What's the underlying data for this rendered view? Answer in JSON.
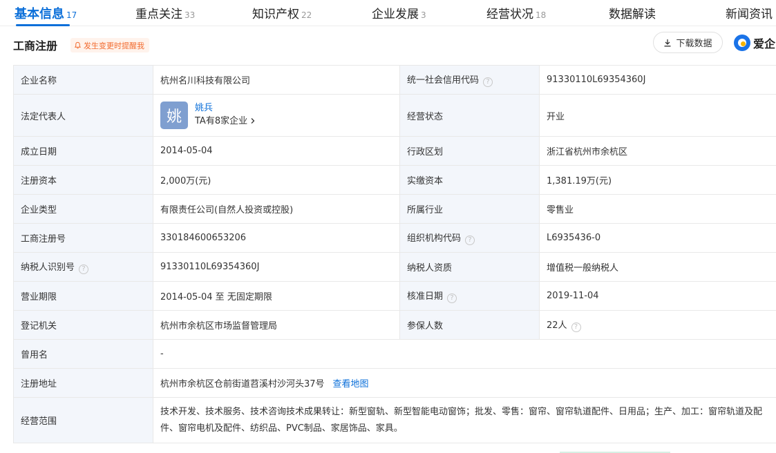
{
  "tabs": [
    {
      "label": "基本信息",
      "count": "17"
    },
    {
      "label": "重点关注",
      "count": "33"
    },
    {
      "label": "知识产权",
      "count": "22"
    },
    {
      "label": "企业发展",
      "count": "3"
    },
    {
      "label": "经营状况",
      "count": "18"
    },
    {
      "label": "数据解读",
      "count": ""
    },
    {
      "label": "新闻资讯",
      "count": ""
    }
  ],
  "section": {
    "title": "工商注册",
    "remind_label": "发生变更时提醒我",
    "download_label": "下载数据",
    "brand_label": "爱企"
  },
  "fields": {
    "company_name": {
      "label": "企业名称",
      "value": "杭州名川科技有限公司"
    },
    "credit_code": {
      "label": "统一社会信用代码",
      "value": "91330110L69354360J"
    },
    "legal_rep": {
      "label": "法定代表人",
      "avatar_char": "姚",
      "name": "姚兵",
      "companies": "TA有8家企业"
    },
    "status": {
      "label": "经营状态",
      "value": "开业"
    },
    "founded": {
      "label": "成立日期",
      "value": "2014-05-04"
    },
    "region": {
      "label": "行政区划",
      "value": "浙江省杭州市余杭区"
    },
    "reg_capital": {
      "label": "注册资本",
      "value": "2,000万(元)"
    },
    "paid_capital": {
      "label": "实缴资本",
      "value": "1,381.19万(元)"
    },
    "type": {
      "label": "企业类型",
      "value": "有限责任公司(自然人投资或控股)"
    },
    "industry": {
      "label": "所属行业",
      "value": "零售业"
    },
    "reg_no": {
      "label": "工商注册号",
      "value": "330184600653206"
    },
    "org_code": {
      "label": "组织机构代码",
      "value": "L6935436-0"
    },
    "taxpayer_id": {
      "label": "纳税人识别号",
      "value": "91330110L69354360J"
    },
    "taxpayer_qual": {
      "label": "纳税人资质",
      "value": "增值税一般纳税人"
    },
    "term": {
      "label": "营业期限",
      "value": "2014-05-04 至 无固定期限"
    },
    "approve_date": {
      "label": "核准日期",
      "value": "2019-11-04"
    },
    "authority": {
      "label": "登记机关",
      "value": "杭州市余杭区市场监督管理局"
    },
    "insured": {
      "label": "参保人数",
      "value": "22人"
    },
    "former_name": {
      "label": "曾用名",
      "value": "-"
    },
    "address": {
      "label": "注册地址",
      "value": "杭州市余杭区仓前街道苕溪村沙河头37号",
      "map_link": "查看地图"
    },
    "scope": {
      "label": "经营范围",
      "value": "技术开发、技术服务、技术咨询技术成果转让：新型窗轨、新型智能电动窗饰；批发、零售：窗帘、窗帘轨道配件、日用品；生产、加工：窗帘轨道及配件、窗帘电机及配件、纺织品、PVC制品、家居饰品、家具。"
    }
  },
  "colors": {
    "accent": "#0b6fd9",
    "label_bg": "#f3f6fb",
    "remind": "#f26b2f"
  },
  "icons": {
    "remind": "bell-icon",
    "download": "download-icon",
    "help": "question-circle-icon",
    "chevron": "chevron-right-icon"
  }
}
